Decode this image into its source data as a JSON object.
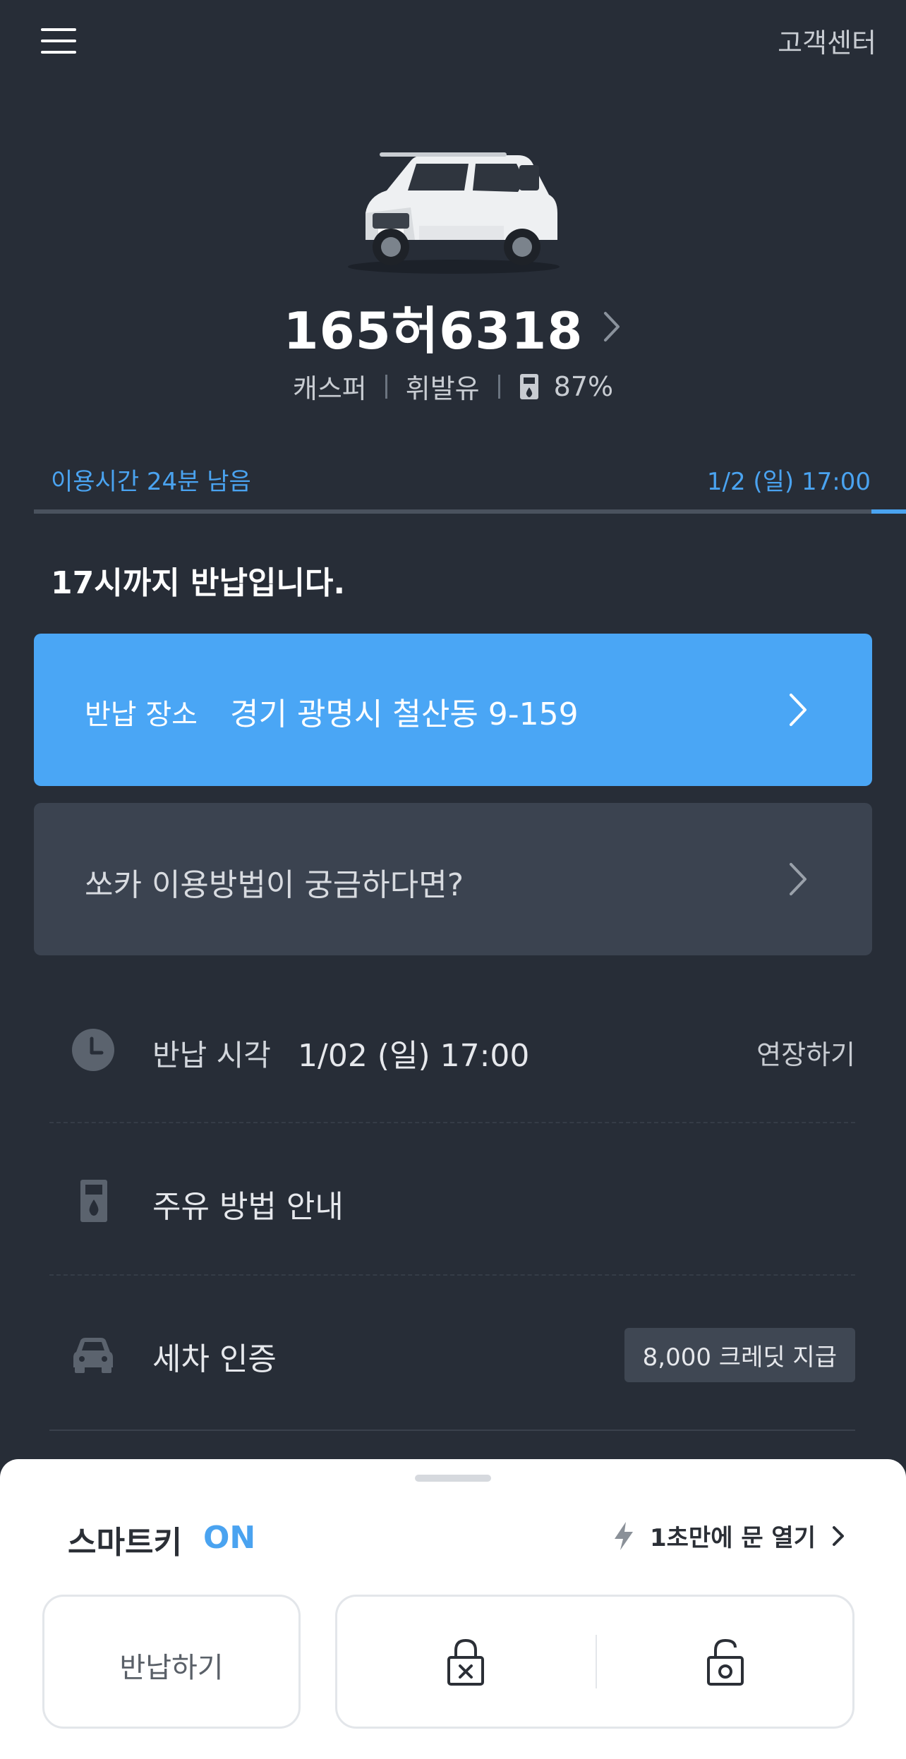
{
  "header": {
    "menu_icon": "hamburger-menu-icon",
    "customer_center": "고객센터"
  },
  "vehicle": {
    "plate": "165허6318",
    "model": "캐스퍼",
    "fuel_type": "휘발유",
    "fuel_level": "87%"
  },
  "usage": {
    "remaining": "이용시간 24분 남음",
    "end_time": "1/2 (일) 17:00",
    "progress_fraction": 0.04
  },
  "return_notice": "17시까지 반납입니다.",
  "return_location": {
    "label": "반납 장소",
    "address": "경기 광명시 철산동 9-159"
  },
  "guide_card": "쏘카 이용방법이 궁금하다면?",
  "rows": {
    "return_time": {
      "label": "반납 시각",
      "value": "1/02 (일) 17:00",
      "action": "연장하기",
      "icon": "clock-icon"
    },
    "fuel_guide": {
      "label": "주유 방법 안내",
      "icon": "fuel-pump-icon"
    },
    "car_wash": {
      "label": "세차 인증",
      "badge": "8,000 크레딧 지급",
      "icon": "car-icon"
    }
  },
  "smart_key": {
    "label": "스마트키",
    "status": "ON",
    "quick_open": "1초만에 문 열기",
    "return_button": "반납하기",
    "lock_icon": "lock-icon",
    "unlock_icon": "unlock-icon"
  },
  "colors": {
    "background": "#272d37",
    "accent": "#4aa3f0",
    "card_blue": "#4aa6f5",
    "card_gray": "#3b4350"
  }
}
